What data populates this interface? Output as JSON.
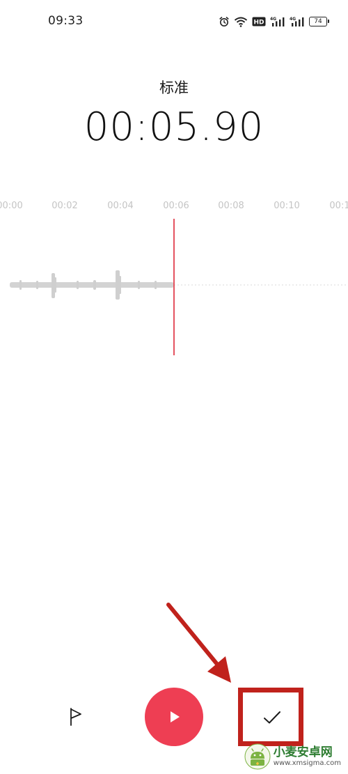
{
  "status_bar": {
    "time": "09:33",
    "battery": "74",
    "icons": [
      "alarm-icon",
      "wifi-icon",
      "hd-icon",
      "signal-4g-icon",
      "signal-4g-icon"
    ]
  },
  "recorder": {
    "mode": "标准",
    "elapsed": "00:05.90"
  },
  "timeline": {
    "ticks": [
      "00:00",
      "00:02",
      "00:04",
      "00:06",
      "00:08",
      "00:10",
      "00:1"
    ]
  },
  "controls": {
    "flag_icon": "flag-icon",
    "play_icon": "play-icon",
    "done_icon": "check-icon"
  },
  "annotation": {
    "color": "#c0221c"
  },
  "watermark": {
    "cn": "小麦安卓网",
    "url": "www.xmsigma.com"
  },
  "colors": {
    "accent": "#ee3e53",
    "playhead": "#e4525f",
    "waveform": "#cfcfcf",
    "tick": "#c4c4c4"
  }
}
